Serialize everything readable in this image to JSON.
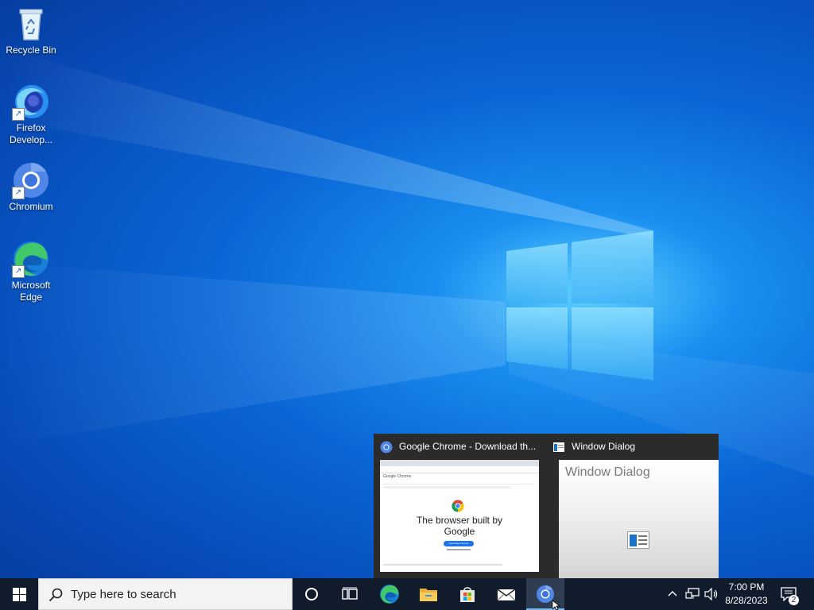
{
  "desktop": {
    "icons": [
      {
        "label": "Recycle Bin",
        "icon": "recycle-bin-icon"
      },
      {
        "label": "Firefox Develop...",
        "icon": "firefox-developer-icon"
      },
      {
        "label": "Chromium",
        "icon": "chromium-icon"
      },
      {
        "label": "Microsoft Edge",
        "icon": "edge-icon"
      }
    ]
  },
  "thumbnails": {
    "chrome": {
      "title": "Google Chrome - Download th...",
      "page_heading": "The browser built by Google",
      "page_logo": "Google Chrome",
      "download_button": "Download Chrome"
    },
    "dialog": {
      "title": "Window Dialog",
      "content_title": "Window Dialog"
    }
  },
  "taskbar": {
    "search_placeholder": "Type here to search",
    "apps": [
      "cortana-icon",
      "task-view-icon",
      "edge-icon",
      "file-explorer-icon",
      "microsoft-store-icon",
      "mail-icon",
      "chromium-icon"
    ],
    "clock_time": "7:00 PM",
    "clock_date": "8/28/2023",
    "notification_count": "2"
  },
  "colors": {
    "taskbar": "#101c2c",
    "accent": "#0a66d6",
    "active_indicator": "#76b9ed"
  }
}
